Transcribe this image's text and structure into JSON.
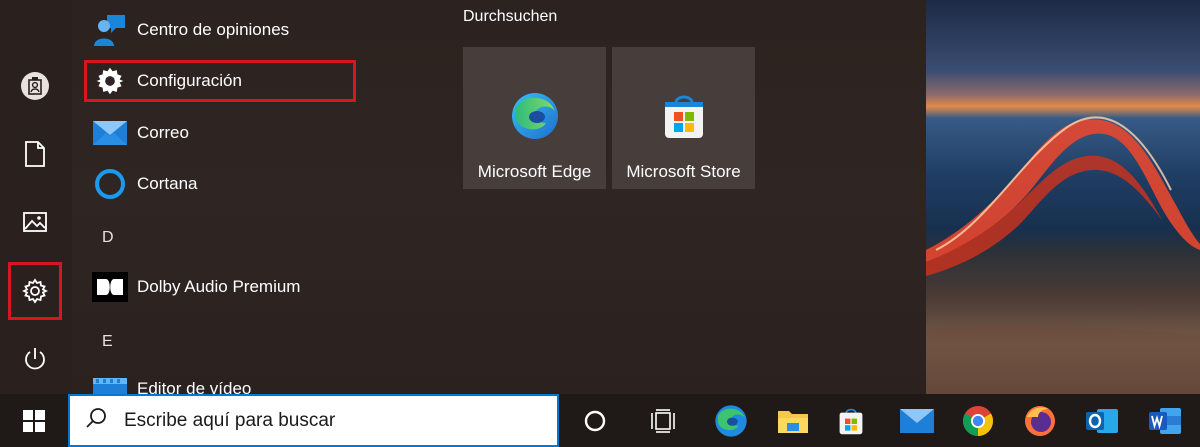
{
  "start_menu": {
    "apps": [
      {
        "label": "Centro de opiniones",
        "icon": "feedback-hub-icon"
      },
      {
        "label": "Configuración",
        "icon": "gear-icon"
      },
      {
        "label": "Correo",
        "icon": "mail-icon"
      },
      {
        "label": "Cortana",
        "icon": "cortana-icon"
      },
      {
        "label": "Dolby Audio Premium",
        "icon": "dolby-icon"
      },
      {
        "label": "Editor de vídeo",
        "icon": "video-editor-icon"
      }
    ],
    "letters": [
      "D",
      "E"
    ],
    "group_title": "Durchsuchen",
    "tiles": [
      {
        "label": "Microsoft Edge",
        "icon": "edge-icon"
      },
      {
        "label": "Microsoft Store",
        "icon": "store-icon"
      }
    ]
  },
  "rail": {
    "icons": [
      "user-icon",
      "document-icon",
      "pictures-icon",
      "gear-icon",
      "power-icon"
    ]
  },
  "taskbar": {
    "search_placeholder": "Escribe aquí para buscar",
    "pinned": [
      "cortana-icon",
      "task-view-icon",
      "edge-icon",
      "file-explorer-icon",
      "store-icon",
      "mail-icon",
      "chrome-icon",
      "firefox-icon",
      "outlook-icon",
      "word-icon"
    ]
  },
  "colors": {
    "highlight": "#d7161f",
    "accent": "#0078d4",
    "tile_bg": "#473d3a"
  }
}
